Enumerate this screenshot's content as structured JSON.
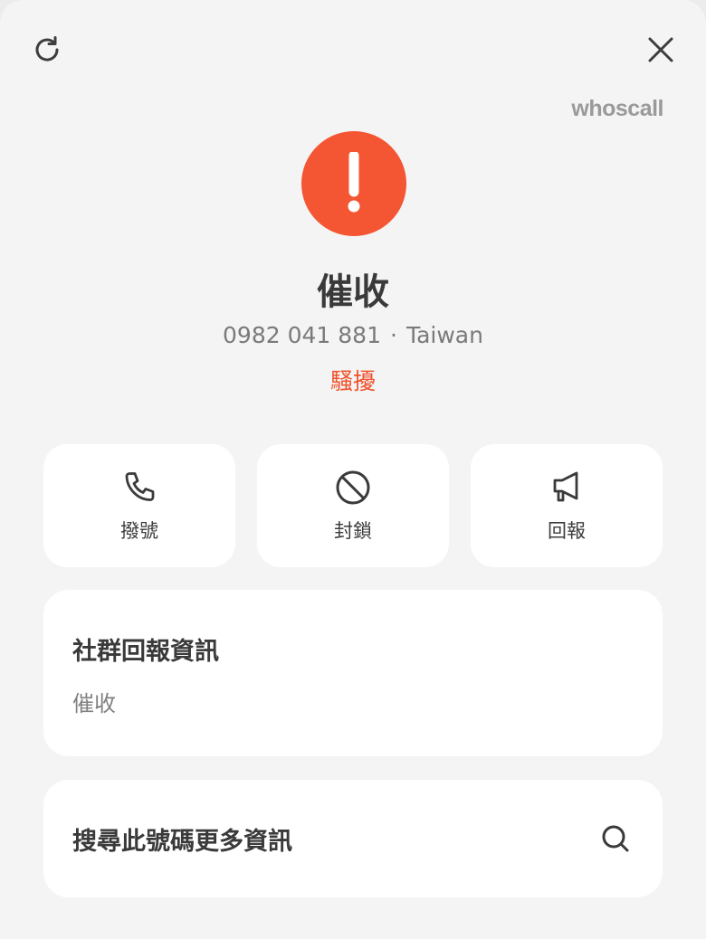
{
  "header": {
    "refresh_icon": "refresh-icon",
    "close_icon": "close-icon",
    "brand": "whoscall"
  },
  "caller": {
    "alert_icon": "exclamation-icon",
    "alert_color": "#f45532",
    "name": "催收",
    "number": "0982 041 881",
    "separator": "·",
    "region": "Taiwan",
    "category": "騷擾",
    "category_color": "#f0522d"
  },
  "actions": [
    {
      "label": "撥號",
      "icon": "phone-icon"
    },
    {
      "label": "封鎖",
      "icon": "block-icon"
    },
    {
      "label": "回報",
      "icon": "megaphone-icon"
    }
  ],
  "community": {
    "title": "社群回報資訊",
    "value": "催收"
  },
  "search": {
    "title": "搜尋此號碼更多資訊",
    "icon": "search-icon"
  }
}
